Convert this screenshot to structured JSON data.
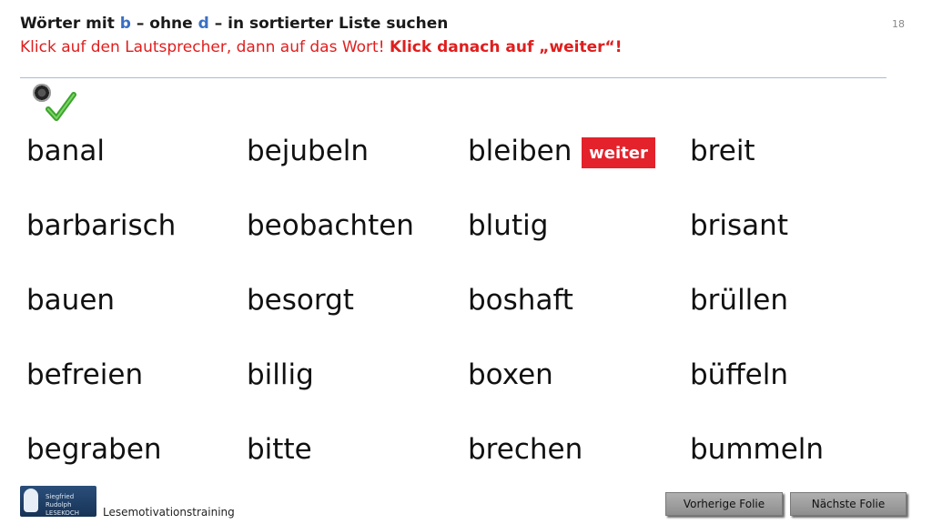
{
  "header": {
    "title_part1": "Wörter mit ",
    "title_b": "b",
    "title_part2": " – ohne ",
    "title_d": "d",
    "title_part3": " – in sortierter Liste suchen",
    "instruction_part1": "Klick auf den Lautsprecher, dann auf das Wort! ",
    "instruction_part2": "Klick danach auf „weiter“!",
    "page_number": "18"
  },
  "icons": {
    "speaker": "speaker-icon",
    "check": "checkmark-icon"
  },
  "words": [
    [
      "banal",
      "barbarisch",
      "bauen",
      "befreien",
      "begraben"
    ],
    [
      "bejubeln",
      "beobachten",
      "besorgt",
      "billig",
      "bitte"
    ],
    [
      "bleiben",
      "blutig",
      "boshaft",
      "boxen",
      "brechen"
    ],
    [
      "breit",
      "brisant",
      "brüllen",
      "büffeln",
      "bummeln"
    ]
  ],
  "weiter_label": "weiter",
  "footer": {
    "label": "Lesemotivationstraining",
    "logo_text": "Siegfried Rudolph LESEKOCH",
    "prev_label": "Vorherige  Folie",
    "next_label": "Nächste  Folie"
  },
  "colors": {
    "accent_red": "#e3222b",
    "letter_blue": "#3a6fc4",
    "divider": "#a9bcd6"
  }
}
